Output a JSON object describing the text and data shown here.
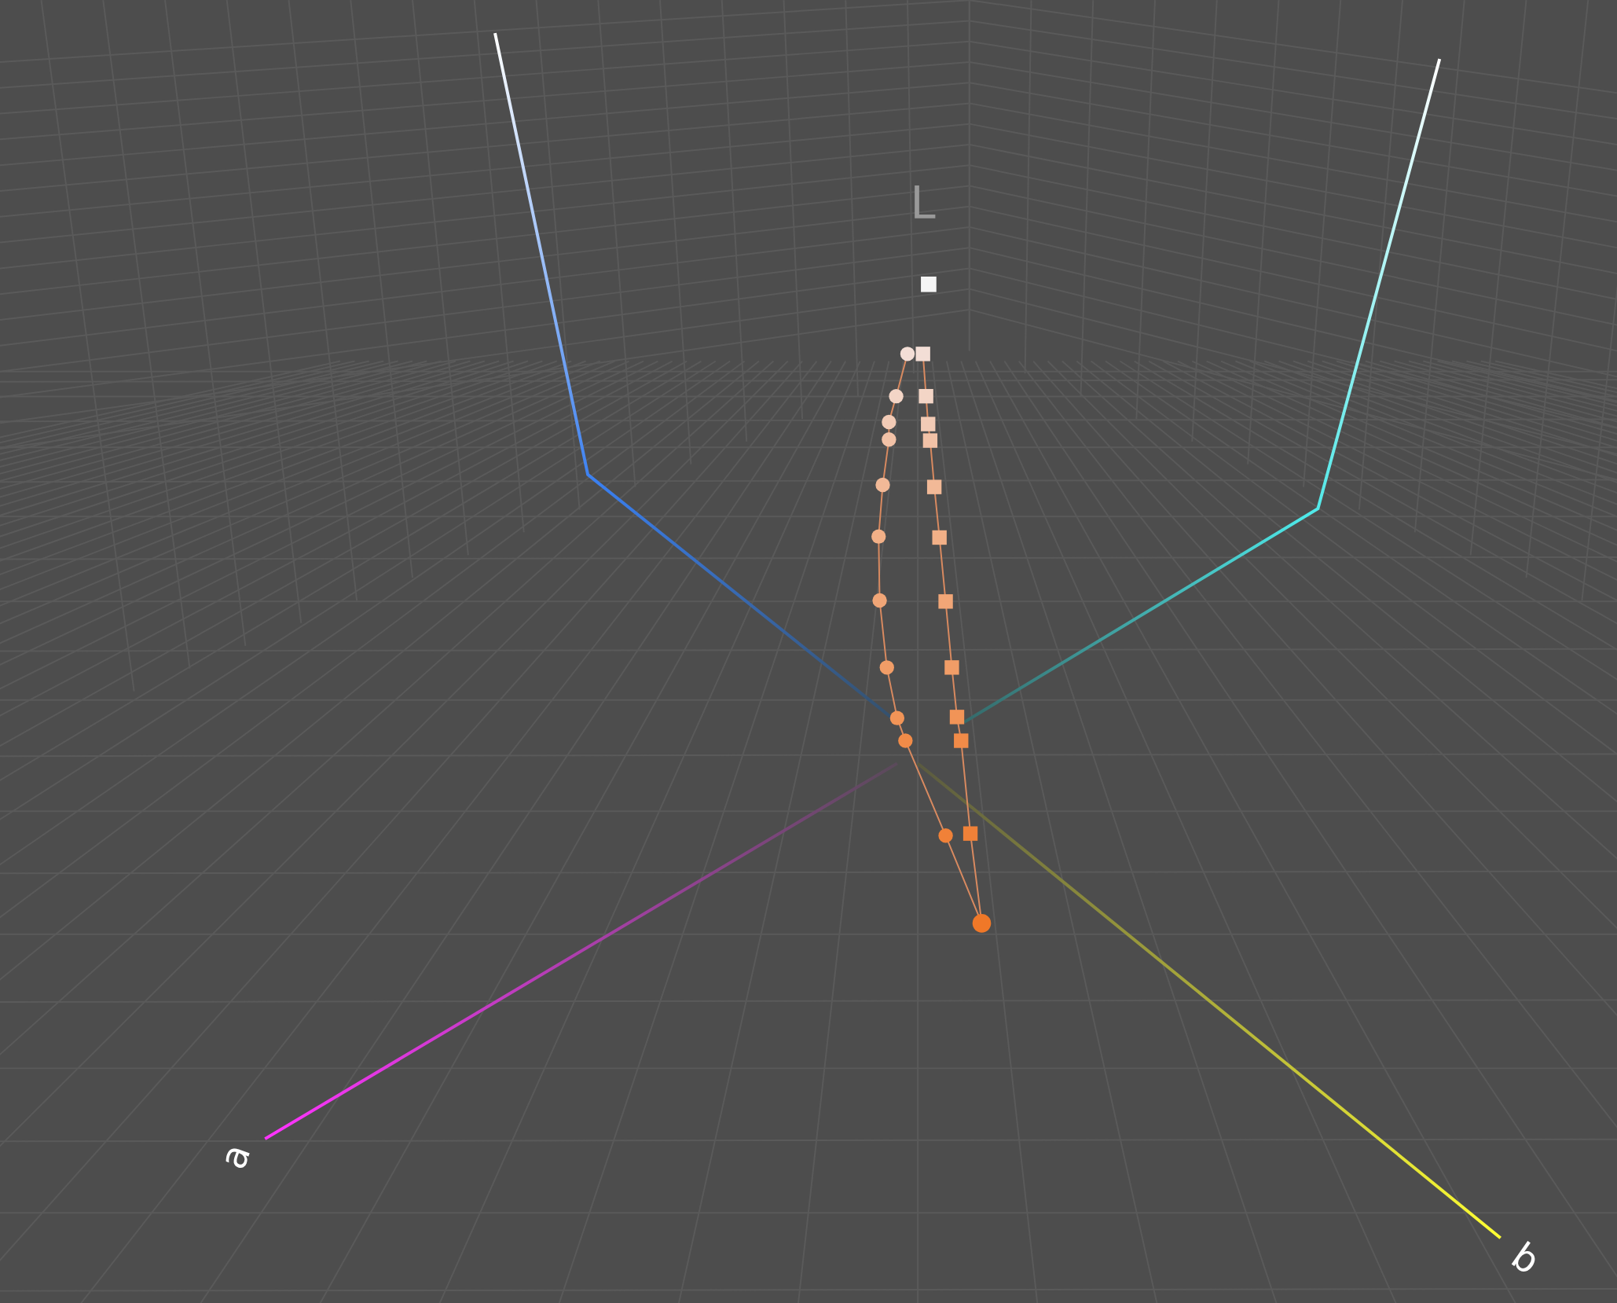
{
  "axes": [
    {
      "kind": "l",
      "label": "L"
    },
    {
      "kind": "a",
      "label": "a"
    },
    {
      "kind": "b",
      "label": "b"
    }
  ]
}
